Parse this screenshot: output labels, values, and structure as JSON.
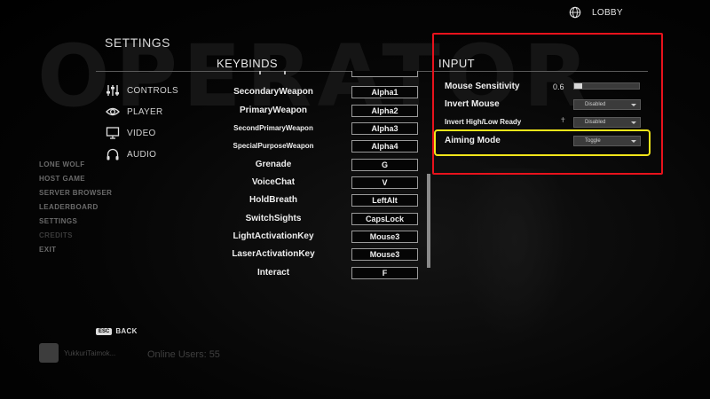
{
  "header": {
    "lobby_label": "LOBBY",
    "lobby_icon": "globe-icon"
  },
  "background": {
    "logo_text": "OPERATOR"
  },
  "settings": {
    "title": "SETTINGS"
  },
  "tabs": [
    {
      "label": "CONTROLS",
      "icon": "sliders-icon"
    },
    {
      "label": "PLAYER",
      "icon": "eye-icon"
    },
    {
      "label": "VIDEO",
      "icon": "monitor-icon"
    },
    {
      "label": "AUDIO",
      "icon": "headphones-icon"
    }
  ],
  "main_menu": [
    {
      "label": "LONE WOLF"
    },
    {
      "label": "HOST GAME"
    },
    {
      "label": "SERVER BROWSER"
    },
    {
      "label": "LEADERBOARD"
    },
    {
      "label": "SETTINGS"
    },
    {
      "label": "CREDITS"
    },
    {
      "label": "EXIT"
    }
  ],
  "keybinds": {
    "heading": "KEYBINDS",
    "rows": [
      {
        "action": "SecondaryWeapon",
        "key": "Alpha1"
      },
      {
        "action": "PrimaryWeapon",
        "key": "Alpha2"
      },
      {
        "action": "SecondPrimaryWeapon",
        "key": "Alpha3"
      },
      {
        "action": "SpecialPurposeWeapon",
        "key": "Alpha4"
      },
      {
        "action": "Grenade",
        "key": "G"
      },
      {
        "action": "VoiceChat",
        "key": "V"
      },
      {
        "action": "HoldBreath",
        "key": "LeftAlt"
      },
      {
        "action": "SwitchSights",
        "key": "CapsLock"
      },
      {
        "action": "LightActivationKey",
        "key": "Mouse3"
      },
      {
        "action": "LaserActivationKey",
        "key": "Mouse3"
      },
      {
        "action": "Interact",
        "key": "F"
      }
    ]
  },
  "input": {
    "heading": "INPUT",
    "mouse_sensitivity": {
      "label": "Mouse Sensitivity",
      "value": "0.6",
      "level": 0.12
    },
    "invert_mouse": {
      "label": "Invert Mouse",
      "value": "Disabled"
    },
    "invert_high_low": {
      "label": "Invert High/Low Ready",
      "value": "Disabled"
    },
    "aiming_mode": {
      "label": "Aiming Mode",
      "value": "Toggle"
    }
  },
  "annotations": {
    "red_box": "#e8121c",
    "yellow_box": "#f2e51a"
  },
  "footer": {
    "esc_badge": "ESC",
    "back_label": "BACK",
    "username": "YukkuriTaimok...",
    "online_users": "Online Users: 55"
  }
}
